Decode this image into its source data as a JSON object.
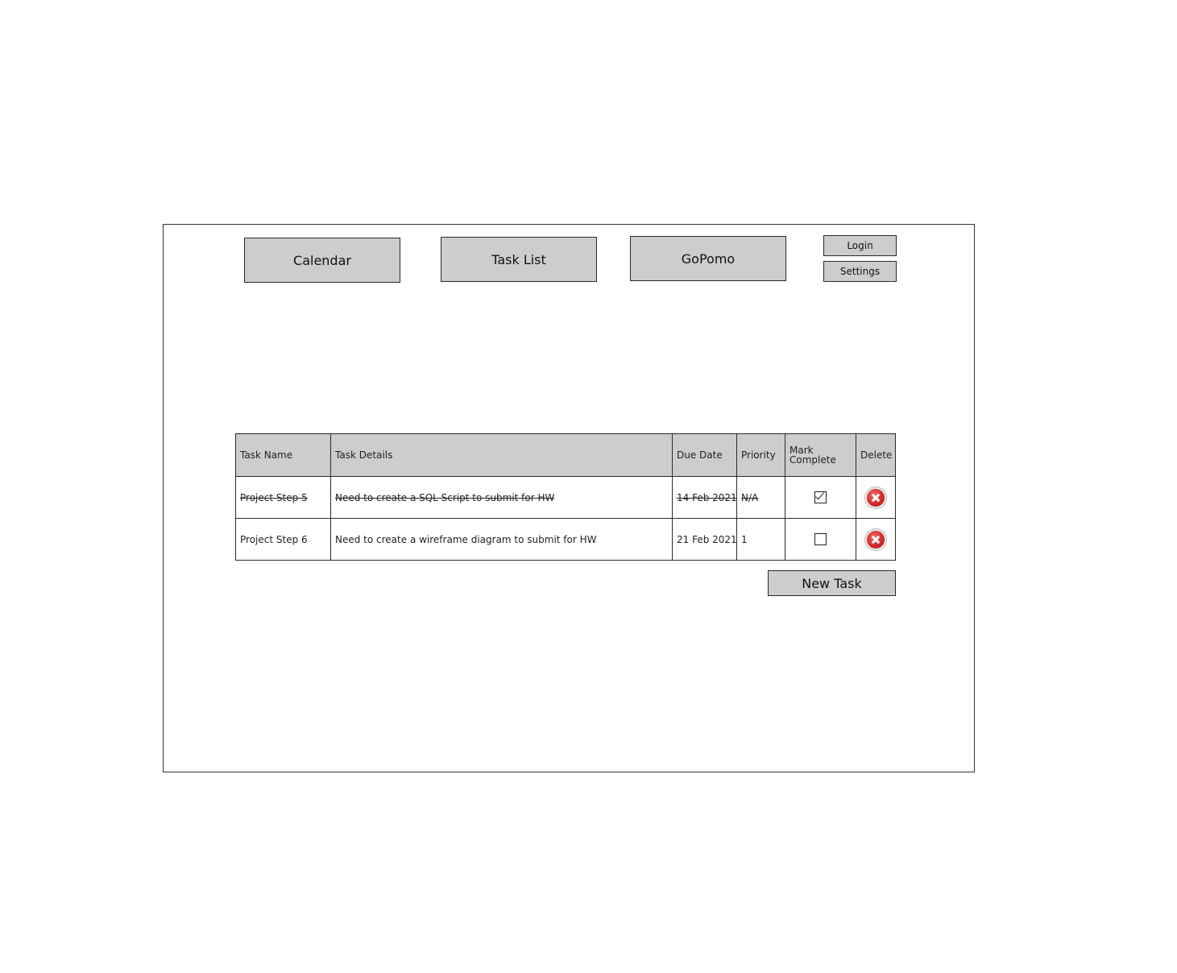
{
  "nav": {
    "calendar": "Calendar",
    "task_list": "Task List",
    "gopomo": "GoPomo"
  },
  "account": {
    "login": "Login",
    "settings": "Settings"
  },
  "table": {
    "headers": {
      "task_name": "Task Name",
      "task_details": "Task Details",
      "due_date": "Due Date",
      "priority": "Priority",
      "mark_complete": "Mark Complete",
      "delete": "Delete"
    },
    "rows": [
      {
        "task_name": "Project Step 5",
        "task_details": "Need to create a SQL Script to submit for HW",
        "due_date": "14 Feb 2021",
        "priority": "N/A",
        "completed": true
      },
      {
        "task_name": "Project Step 6",
        "task_details": "Need to create a wireframe diagram to submit for HW",
        "due_date": "21 Feb 2021",
        "priority": "1",
        "completed": false
      }
    ]
  },
  "actions": {
    "new_task": "New Task"
  },
  "icons": {
    "delete": "delete-circle-x-icon",
    "checkbox_checked": "checkbox-checked-icon",
    "checkbox_unchecked": "checkbox-unchecked-icon"
  },
  "colors": {
    "button_fill": "#cdcdcd",
    "delete_red": "#d42b2b"
  }
}
